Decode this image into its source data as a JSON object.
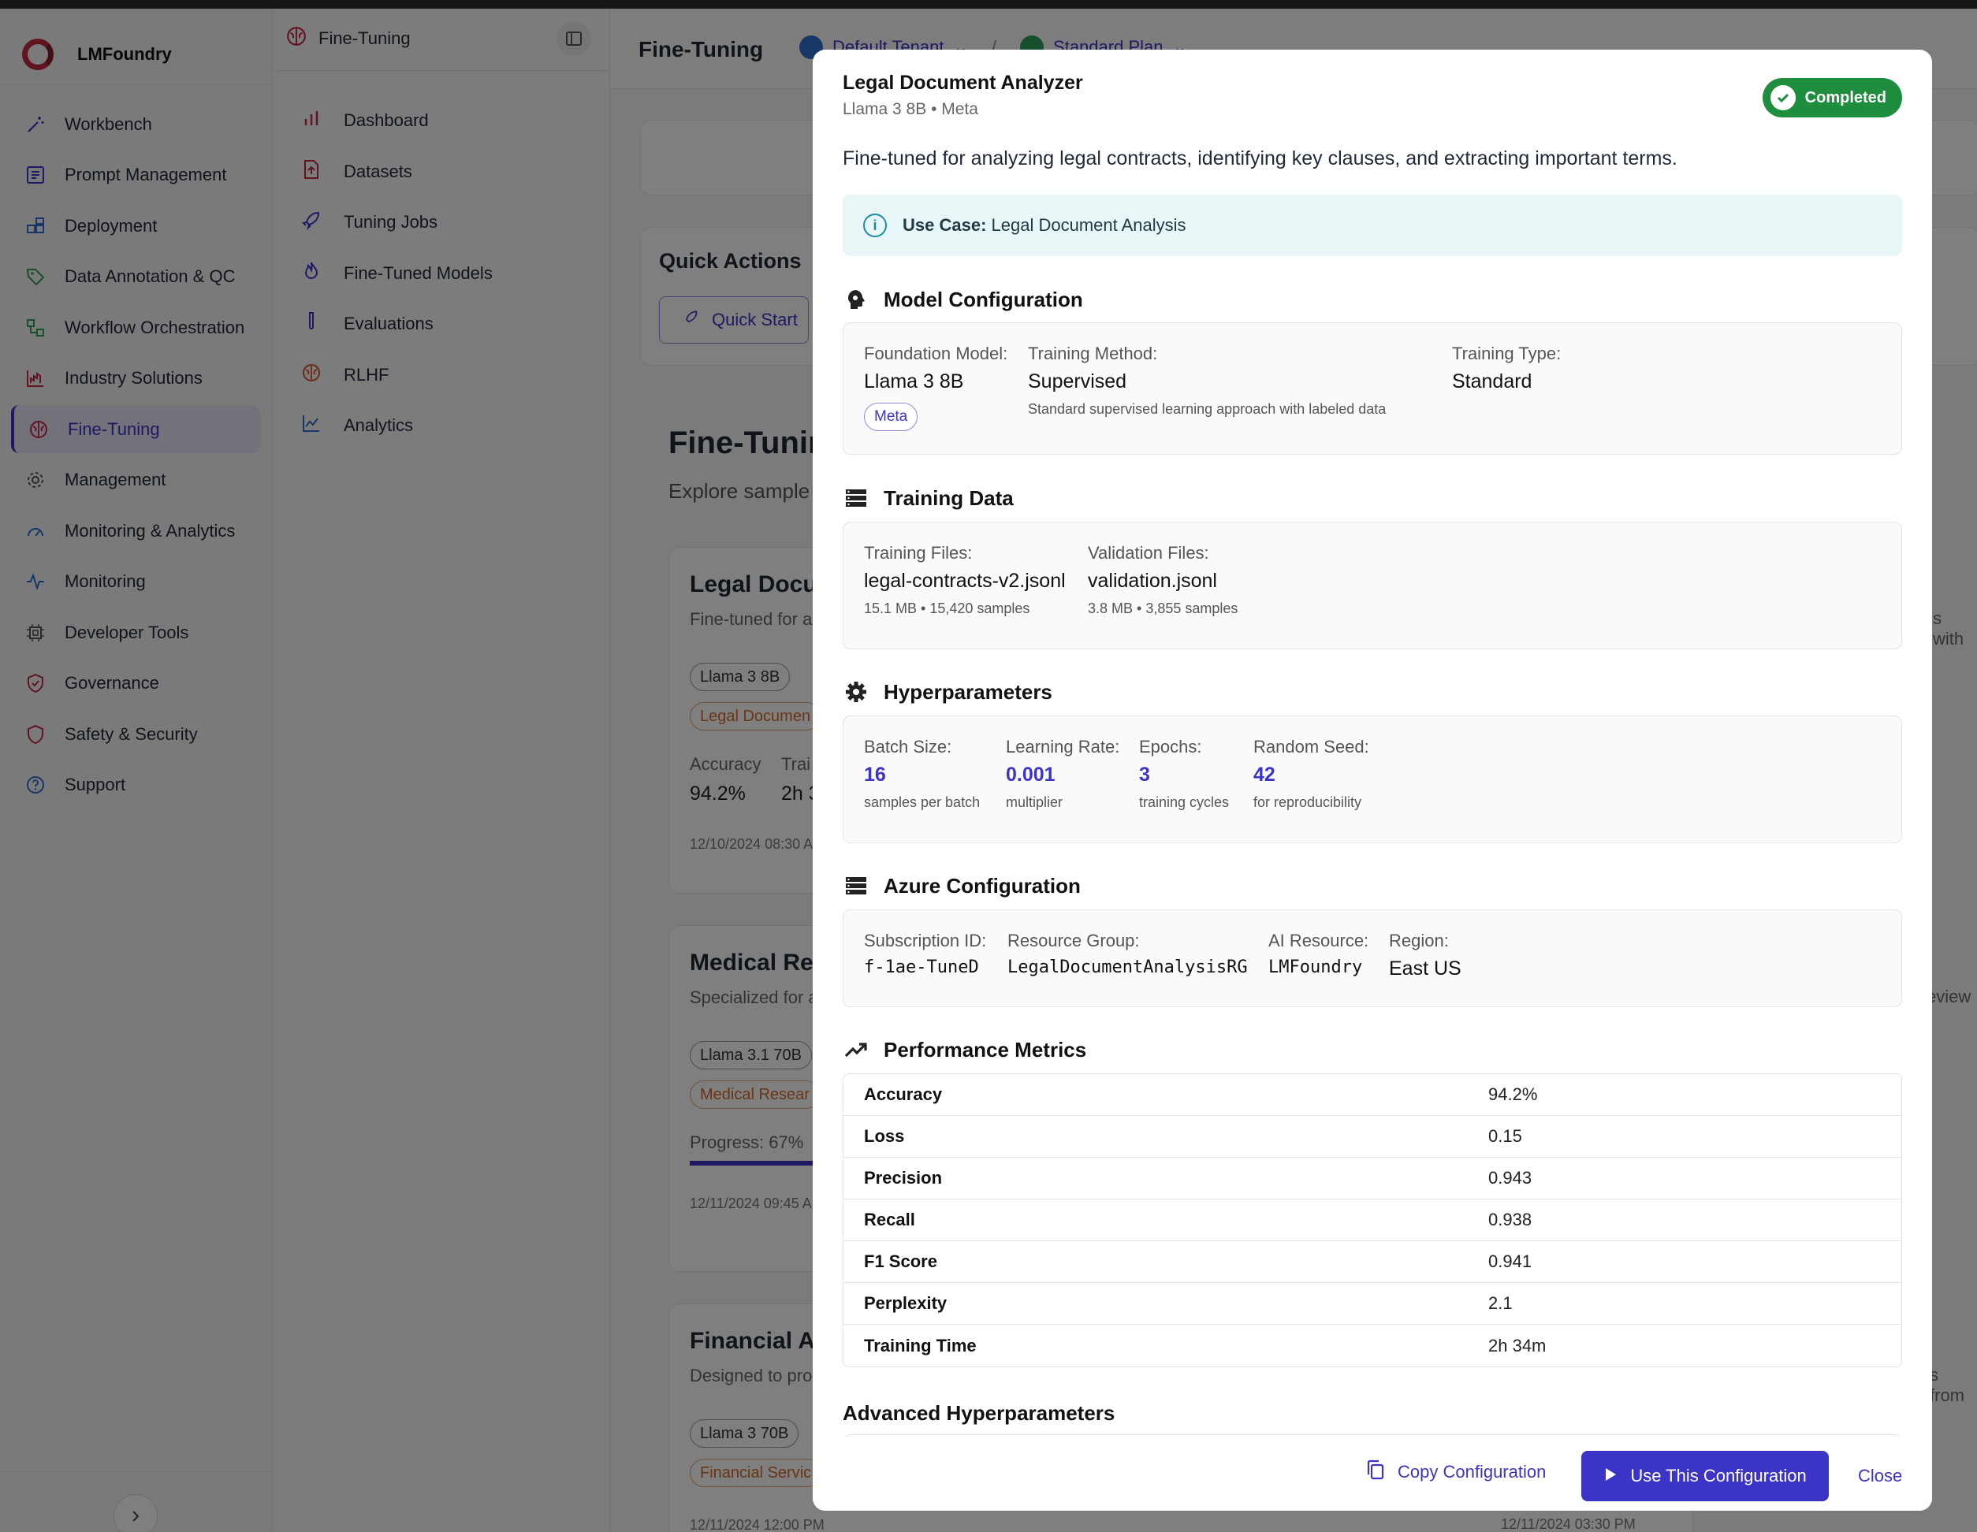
{
  "app": {
    "name": "LMFoundry"
  },
  "sidebar": {
    "items": [
      {
        "label": "Workbench",
        "icon": "wand-icon"
      },
      {
        "label": "Prompt Management",
        "icon": "prompt-icon"
      },
      {
        "label": "Deployment",
        "icon": "deploy-icon"
      },
      {
        "label": "Data Annotation & QC",
        "icon": "tag-icon"
      },
      {
        "label": "Workflow Orchestration",
        "icon": "workflow-icon"
      },
      {
        "label": "Industry Solutions",
        "icon": "industry-icon"
      },
      {
        "label": "Fine-Tuning",
        "icon": "brain-icon"
      },
      {
        "label": "Management",
        "icon": "gear-icon"
      },
      {
        "label": "Monitoring & Analytics",
        "icon": "gauge-icon"
      },
      {
        "label": "Monitoring",
        "icon": "pulse-icon"
      },
      {
        "label": "Developer Tools",
        "icon": "chip-icon"
      },
      {
        "label": "Governance",
        "icon": "shield-check-icon"
      },
      {
        "label": "Safety & Security",
        "icon": "shield-icon"
      },
      {
        "label": "Support",
        "icon": "help-icon"
      }
    ]
  },
  "subnav": {
    "title": "Fine-Tuning",
    "items": [
      {
        "label": "Dashboard",
        "icon": "bar-chart-icon"
      },
      {
        "label": "Datasets",
        "icon": "file-upload-icon"
      },
      {
        "label": "Tuning Jobs",
        "icon": "rocket-icon"
      },
      {
        "label": "Fine-Tuned Models",
        "icon": "flame-icon"
      },
      {
        "label": "Evaluations",
        "icon": "test-tube-icon"
      },
      {
        "label": "RLHF",
        "icon": "brain-icon"
      },
      {
        "label": "Analytics",
        "icon": "line-chart-icon"
      }
    ]
  },
  "header": {
    "title": "Fine-Tuning",
    "tenant": "Default Tenant",
    "plan": "Standard Plan"
  },
  "main": {
    "quick_actions_title": "Quick Actions",
    "quick_start": "Quick Start",
    "section_title": "Fine-Tunin",
    "section_sub": "Explore sample",
    "cards": [
      {
        "title": "Legal Docur",
        "sub": "Fine-tuned for a",
        "chip1": "Llama 3 8B",
        "chip2": "Legal Documen",
        "acc_label": "Accuracy",
        "acc_value": "94.2%",
        "train_label": "Trai",
        "train_value": "2h 3",
        "date": "12/10/2024 08:30 A",
        "right": "s with"
      },
      {
        "title": "Medical Res",
        "sub": "Specialized for a",
        "chip1": "Llama 3.1 70B",
        "chip2": "Medical Resear",
        "progress": "Progress: 67%",
        "date": "12/11/2024 09:45 A",
        "right": "eview"
      },
      {
        "title": "Financial Ac",
        "sub": "Designed to pro",
        "chip1": "Llama 3 70B",
        "chip2": "Financial Servic",
        "date": "12/11/2024 12:00 PM",
        "date2": "12/11/2024 03:30 PM",
        "right": "s from"
      }
    ]
  },
  "modal": {
    "title": "Legal Document Analyzer",
    "subtitle": "Llama 3 8B • Meta",
    "status": "Completed",
    "description": "Fine-tuned for analyzing legal contracts, identifying key clauses, and extracting important terms.",
    "use_case_label": "Use Case:",
    "use_case_value": "Legal Document Analysis",
    "model_config": {
      "title": "Model Configuration",
      "foundation_label": "Foundation Model:",
      "foundation_value": "Llama 3 8B",
      "provider_chip": "Meta",
      "method_label": "Training Method:",
      "method_value": "Supervised",
      "method_note": "Standard supervised learning approach with labeled data",
      "type_label": "Training Type:",
      "type_value": "Standard"
    },
    "training_data": {
      "title": "Training Data",
      "train_label": "Training Files:",
      "train_value": "legal-contracts-v2.jsonl",
      "train_note": "15.1 MB • 15,420 samples",
      "val_label": "Validation Files:",
      "val_value": "validation.jsonl",
      "val_note": "3.8 MB • 3,855 samples"
    },
    "hyperparameters": {
      "title": "Hyperparameters",
      "batch_label": "Batch Size:",
      "batch_value": "16",
      "batch_note": "samples per batch",
      "lr_label": "Learning Rate:",
      "lr_value": "0.001",
      "lr_note": "multiplier",
      "epochs_label": "Epochs:",
      "epochs_value": "3",
      "epochs_note": "training cycles",
      "seed_label": "Random Seed:",
      "seed_value": "42",
      "seed_note": "for reproducibility"
    },
    "azure": {
      "title": "Azure Configuration",
      "sub_label": "Subscription ID:",
      "sub_value": "f-1ae-TuneD",
      "rg_label": "Resource Group:",
      "rg_value": "LegalDocumentAnalysisRG",
      "ai_label": "AI Resource:",
      "ai_value": "LMFoundry",
      "region_label": "Region:",
      "region_value": "East US"
    },
    "performance": {
      "title": "Performance Metrics",
      "rows": [
        {
          "k": "Accuracy",
          "v": "94.2%"
        },
        {
          "k": "Loss",
          "v": "0.15"
        },
        {
          "k": "Precision",
          "v": "0.943"
        },
        {
          "k": "Recall",
          "v": "0.938"
        },
        {
          "k": "F1 Score",
          "v": "0.941"
        },
        {
          "k": "Perplexity",
          "v": "2.1"
        },
        {
          "k": "Training Time",
          "v": "2h 34m"
        }
      ]
    },
    "advanced_title": "Advanced Hyperparameters",
    "footer": {
      "copy": "Copy Configuration",
      "use": "Use This Configuration",
      "close": "Close"
    }
  },
  "colors": {
    "accent": "#3b34c7",
    "success": "#1e8e3e",
    "brand": "#c2273e"
  }
}
